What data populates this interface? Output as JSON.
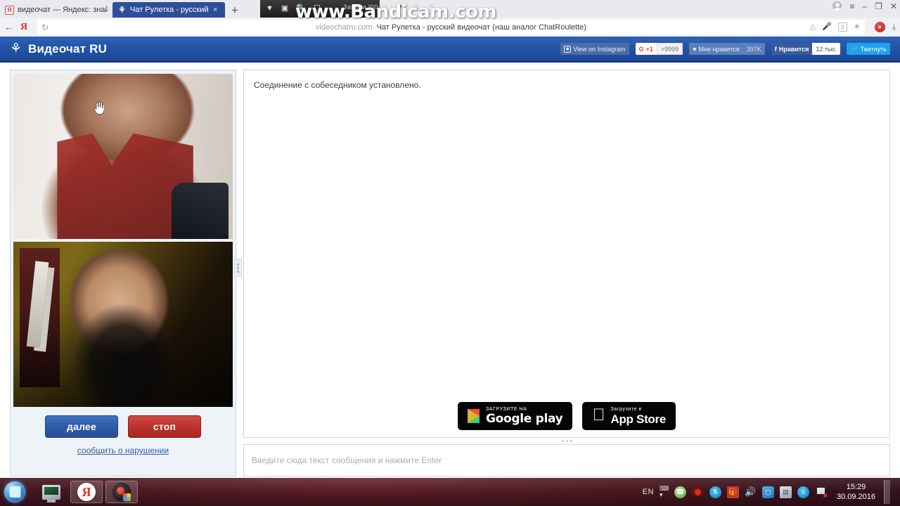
{
  "browser": {
    "tabs": [
      {
        "title": "видеочат — Яндекс: знайш",
        "favicon": "yandex-icon",
        "active": false,
        "close": "×"
      },
      {
        "title": "Чат Рулетка - русский ви",
        "favicon": "videochat-icon",
        "active": true,
        "close": "×"
      }
    ],
    "new_tab_label": "+",
    "window_controls": {
      "menu": "≡",
      "minimize": "–",
      "maximize": "❐",
      "close": "✕"
    },
    "toolbar": {
      "back": "←",
      "yandex_logo": "Я",
      "reload": "↻",
      "url": "videochatru.com",
      "page_title": "Чат Рулетка - русский видеочат (наш аналог ChatRoulette)",
      "camera_icon": "▣",
      "mic_icon": "⭐",
      "reader_icon": "▭",
      "bookmark_icon": "★",
      "download_icon": "⤓"
    }
  },
  "bandicam": {
    "watermark": "www.Bandicam.com",
    "time": "Записи [00:01:12]",
    "icons": [
      "chevron-down",
      "window",
      "magnifier",
      "region"
    ],
    "controls": {
      "record": "●",
      "camera": "▣",
      "close": "✕"
    }
  },
  "site": {
    "logo_text": "Видеочат RU",
    "logo_icon": "flower-icon",
    "social": [
      {
        "name": "instagram",
        "label": "View on Instagram",
        "count": ""
      },
      {
        "name": "google-plus",
        "label": "+1",
        "prefix": "G",
        "count": ">9999"
      },
      {
        "name": "vk",
        "label": "Мне нравится",
        "count": "397K"
      },
      {
        "name": "facebook",
        "label": "Нравится",
        "prefix": "f",
        "count": "12 тыс."
      },
      {
        "name": "twitter",
        "label": "Твитнуть",
        "count": ""
      }
    ]
  },
  "left_panel": {
    "remote_video_label": "remote-video",
    "local_video_label": "local-video",
    "next_button": "далее",
    "stop_button": "стоп",
    "report_link": "сообщить о нарушении"
  },
  "chat": {
    "system_message": "Соединение с собеседником установлено.",
    "input_placeholder": "Введите сюда текст сообщения и нажмите Enter",
    "input_value": ""
  },
  "stores": [
    {
      "name": "google-play",
      "small": "ЗАГРУЗИТЕ НА",
      "big": "Google play"
    },
    {
      "name": "app-store",
      "small": "Загрузите в",
      "big": "App Store"
    }
  ],
  "taskbar": {
    "start_label": "Пуск",
    "items": [
      {
        "name": "show-desktop",
        "icon": "computer-icon"
      },
      {
        "name": "yandex-browser",
        "icon": "Y"
      },
      {
        "name": "bandicam",
        "icon": "bandicam-icon"
      }
    ],
    "tray": {
      "language": "EN",
      "icons": [
        "viber-icon",
        "record-icon",
        "shazam-icon",
        "gift-icon",
        "volume-icon",
        "update-icon",
        "display-icon",
        "skype-icon",
        "flag-icon"
      ],
      "time": "15:29",
      "date": "30.09.2016"
    }
  }
}
